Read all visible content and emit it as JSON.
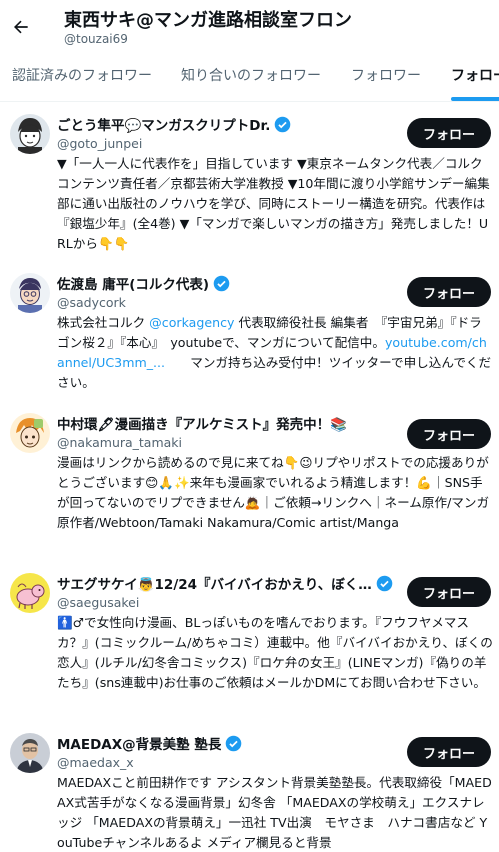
{
  "header": {
    "back_icon": "arrow-left-icon",
    "title": "東西サキ@マンガ進路相談室フロン",
    "handle": "@touzai69"
  },
  "tabs": [
    {
      "label": "認証済みのフォロワー",
      "active": false
    },
    {
      "label": "知り合いのフォロワー",
      "active": false
    },
    {
      "label": "フォロワー",
      "active": false
    },
    {
      "label": "フォロー中",
      "active": true
    }
  ],
  "colors": {
    "accent": "#1d9bf0",
    "text": "#0f1419",
    "secondary": "#536471",
    "button": "#0f1419"
  },
  "users": [
    {
      "name": "ごとう隼平💬マンガスクリプトDr.",
      "handle": "@goto_junpei",
      "button": "フォロー",
      "verified": true,
      "bio": "▼「一人一人に代表作を」目指しています ▼東京ネームタンク代表／コルクコンテンツ責任者／京都芸術大学准教授 ▼10年間に渡り小学館サンデー編集部に通い出版社のノウハウを学び、同時にストーリー構造を研究。代表作は『銀塩少年』(全4巻) ▼「マンガで楽しいマンガの描き方」発売しました！URLから👇👇"
    },
    {
      "name": "佐渡島 庸平(コルク代表)",
      "handle": "@sadycork",
      "button": "フォロー",
      "verified": true,
      "bio_pre": "株式会社コルク ",
      "bio_link1": "@corkagency",
      "bio_mid": " 代表取締役社長 編集者　『宇宙兄弟』『ドラゴン桜２』『本心』　youtubeで、マンガについて配信中。",
      "bio_link2": "youtube.com/channel/UC3mm_...",
      "bio_post": "　　マンガ持ち込み受付中！ツイッターで申し込んでください。"
    },
    {
      "name": "中村環🖋漫画描き『アルケミスト』発売中！📚",
      "handle": "@nakamura_tamaki",
      "button": "フォロー",
      "verified": false,
      "bio": "漫画はリンクから読めるので見に来てね👇😉リプやリポストでの応援ありがとうございます😊🙏✨来年も漫画家でいれるよう精進します！💪｜SNS手が回ってないのでリプできません🙇｜ご依頼→リンクへ｜ネーム原作/マンガ原作者/Webtoon/Tamaki Nakamura/Comic artist/Manga"
    },
    {
      "name": "サエグサケイ👼12/24『バイバイおかえり、ぼく…",
      "handle": "@saegusakei",
      "button": "フォロー",
      "verified": true,
      "bio": "🚹♂で女性向け漫画、BLっぽいものを嗜んでおります。『フウフヤメマスカ？』(コミックルーム/めちゃコミ）連載中。他『バイバイおかえり、ぼくの恋人』(ルチル/幻冬舎コミックス)『ロケ弁の女王』(LINEマンガ)『偽りの羊たち』(sns連載中)お仕事のご依頼はメールかDMにてお問い合わせ下さい。"
    },
    {
      "name": "MAEDAX@背景美塾 塾長",
      "handle": "@maedax_x",
      "button": "フォロー",
      "verified": true,
      "bio": "MAEDAXこと前田耕作です アシスタント背景美塾塾長。代表取締役「MAEDAX式苦手がなくなる漫画背景」幻冬舎 「MAEDAXの学校萌え」エクスナレッジ 「MAEDAXの背景萌え」一迅社 TV出演　モヤさま　ハナコ書店など YouTubeチャンネルあるよ メディア欄見ると背景"
    }
  ]
}
